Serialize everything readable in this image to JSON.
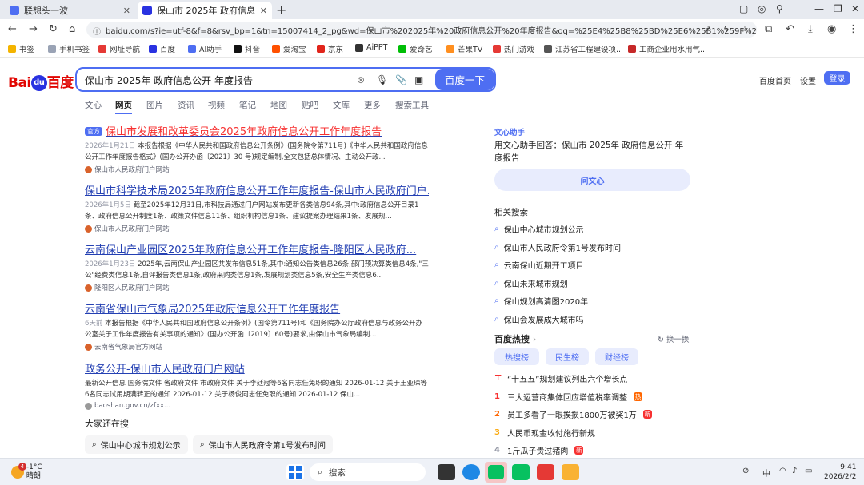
{
  "browser": {
    "tabs": [
      {
        "title": "联想头一波",
        "active": false
      },
      {
        "title": "保山市 2025年 政府信息公开 年度",
        "active": true
      }
    ],
    "url": "baidu.com/s?ie=utf-8&f=8&rsv_bp=1&tn=15007414_2_pg&wd=保山市%202025年%20政府信息公开%20年度报告&oq=%25E4%25B8%25BD%25E6%25B1%259F%25E5%25B8%2582%25...",
    "bookmarks": [
      "书签",
      "手机书签",
      "网址导航",
      "百度",
      "AI助手",
      "抖音",
      "爱淘宝",
      "京东",
      "AiPPT",
      "爱奇艺",
      "芒果TV",
      "热门游戏",
      "江苏省工程建设项...",
      "工商企业用水用气..."
    ]
  },
  "search": {
    "logo_text": "Bai",
    "logo_du": "du",
    "logo_cn": "百度",
    "query": "保山市 2025年 政府信息公开 年度报告",
    "button": "百度一下",
    "top_links": [
      "百度首页",
      "设置"
    ],
    "login": "登录"
  },
  "tabs": [
    "文心",
    "网页",
    "图片",
    "资讯",
    "视频",
    "笔记",
    "地图",
    "贴吧",
    "文库",
    "更多",
    "搜索工具"
  ],
  "results": [
    {
      "badge": "官方",
      "title": "保山市发展和改革委员会2025年政府信息公开工作年度报告",
      "date": "2026年1月21日",
      "desc": "本报告根据《中华人民共和国政府信息公开条例》(国务院令第711号)《中华人民共和国政府信息公开工作年度报告格式》(国办公开办函〔2021〕30 号)规定编制,全文包括总体情况、主动公开政...",
      "source": "保山市人民政府门户网站"
    },
    {
      "title": "保山市科学技术局2025年政府信息公开工作年度报告-保山市人民政府门户...",
      "date": "2026年1月5日",
      "desc": "截至2025年12月31日,市科技局通过门户网站发布更新各类信息94条,其中:政府信息公开目录1条、政府信息公开制度1条、政策文件信息11条、组织机构信息1条、建议提案办理结果1条、发展规...",
      "source": "保山市人民政府门户网站"
    },
    {
      "title": "云南保山产业园区2025年政府信息公开工作年度报告-隆阳区人民政府...",
      "date": "2026年1月23日",
      "desc": "2025年,云南保山产业园区共发布信息51条,其中:通知公告类信息26条,部门预决算类信息4条,\"三公\"经费类信息1条,自评报告类信息1条,政府采购类信息1条,发展规划类信息5条,安全生产类信息6...",
      "source": "隆阳区人民政府门户网站"
    },
    {
      "title": "云南省保山市气象局2025年政府信息公开工作年度报告",
      "date": "6天前",
      "desc": "本报告根据《中华人民共和国政府信息公开条例》(国令第711号)和《国务院办公厅政府信息与政务公开办公室关于工作年度报告有关事项的通知》(国办公开函〔2019〕60号)要求,由保山市气象局编制...",
      "source": "云南省气象局官方网站"
    },
    {
      "title": "政务公开-保山市人民政府门户网站",
      "date": "",
      "desc": "最新公开信息 国务院文件 省政府文件 市政府文件 关于李廷冠等6名同志任免职的通知 2026-01-12 关于王亚琛等6名同志试用期满转正的通知 2026-01-12 关于杨俊同志任免职的通知 2026-01-12 保山...",
      "source": "baoshan.gov.cn/zfxx..."
    }
  ],
  "also_search": {
    "title": "大家还在搜",
    "items": [
      "保山中心城市规划公示",
      "保山市人民政府令第1号发布时间"
    ]
  },
  "right": {
    "wenxin_title": "文心助手",
    "wenxin_q": "用文心助手回答：保山市 2025年 政府信息公开 年度报告",
    "wenxin_btn": "问文心",
    "related_title": "相关搜索",
    "related": [
      "保山中心城市规划公示",
      "保山市人民政府令第1号发布时间",
      "云南保山近期开工项目",
      "保山未来城市规划",
      "保山规划高清图2020年",
      "保山会发展成大城市吗"
    ],
    "hot_title": "百度热搜",
    "hot_swap": "换一换",
    "hot_tabs": [
      "热搜榜",
      "民生榜",
      "财经榜"
    ],
    "hot_items": [
      {
        "rank": "",
        "text": "“十五五”规划建议列出六个增长点",
        "tag": ""
      },
      {
        "rank": "1",
        "text": "三大运营商集体回应增值税率调整",
        "tag": "热"
      },
      {
        "rank": "2",
        "text": "员工多看了一眼挨损1800万被奖1万",
        "tag": "新"
      },
      {
        "rank": "3",
        "text": "人民币现金收付施行新规",
        "tag": ""
      },
      {
        "rank": "4",
        "text": "1斤瓜子贵过猪肉",
        "tag": "新"
      }
    ]
  },
  "taskbar": {
    "temp": "-1°C",
    "weather": "晴朗",
    "badge": "4",
    "search": "搜索",
    "ime": "中",
    "time": "9:41",
    "date": "2026/2/2"
  },
  "colors": {
    "accent": "#4e6ef2",
    "link": "#2440b3",
    "highlight": "#f73131"
  }
}
